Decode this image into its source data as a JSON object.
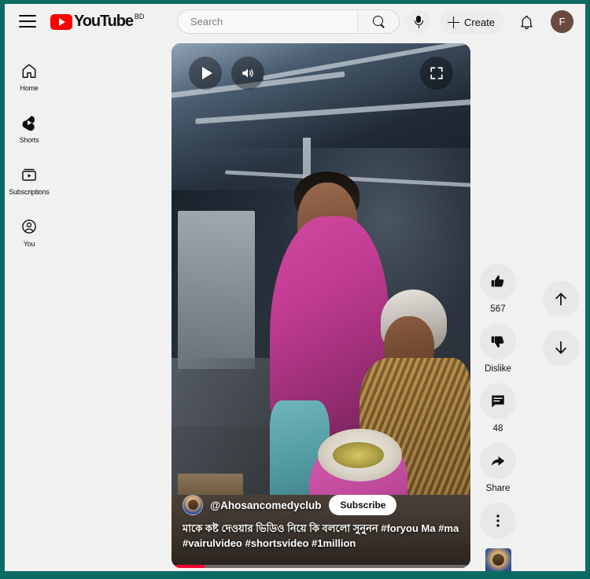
{
  "app": {
    "name": "YouTube",
    "country_code": "BD",
    "accent_color": "#ff0000",
    "background": "#f1f1f1",
    "border_color": "#0b6b63"
  },
  "topbar": {
    "menu_icon": "hamburger-menu-icon",
    "logo_text": "YouTube",
    "logo_superscript": "BD",
    "search": {
      "placeholder": "Search",
      "value": "",
      "button_icon": "search-icon"
    },
    "voice_search_icon": "microphone-icon",
    "create_label": "Create",
    "create_icon": "plus-icon",
    "notifications_icon": "bell-icon",
    "avatar_letter": "F",
    "avatar_color": "#6a4b3f"
  },
  "sidebar": {
    "items": [
      {
        "label": "Home",
        "icon": "home-icon"
      },
      {
        "label": "Shorts",
        "icon": "shorts-icon"
      },
      {
        "label": "Subscriptions",
        "icon": "subscriptions-icon"
      },
      {
        "label": "You",
        "icon": "account-circle-icon"
      }
    ]
  },
  "player": {
    "controls": {
      "play_icon": "play-icon",
      "volume_icon": "volume-on-icon",
      "fullscreen_icon": "fullscreen-icon"
    },
    "progress_percent": 11,
    "progress_color": "#ff0033"
  },
  "video_meta": {
    "channel_handle": "@Ahosancomedyclub",
    "subscribe_label": "Subscribe",
    "description": "মাকে কষ্ট দেওয়ার ভিডিও নিয়ে কি বললো সুনুনন #foryou Ma #ma #vairulvideo #shortsvideo #1million"
  },
  "actions": [
    {
      "name": "like",
      "icon": "thumbs-up-icon",
      "label": "567"
    },
    {
      "name": "dislike",
      "icon": "thumbs-down-icon",
      "label": "Dislike"
    },
    {
      "name": "comments",
      "icon": "comment-icon",
      "label": "48"
    },
    {
      "name": "share",
      "icon": "share-arrow-icon",
      "label": "Share"
    },
    {
      "name": "more",
      "icon": "more-vertical-icon",
      "label": ""
    }
  ],
  "navigation": {
    "previous_icon": "arrow-up-icon",
    "next_icon": "arrow-down-icon"
  }
}
